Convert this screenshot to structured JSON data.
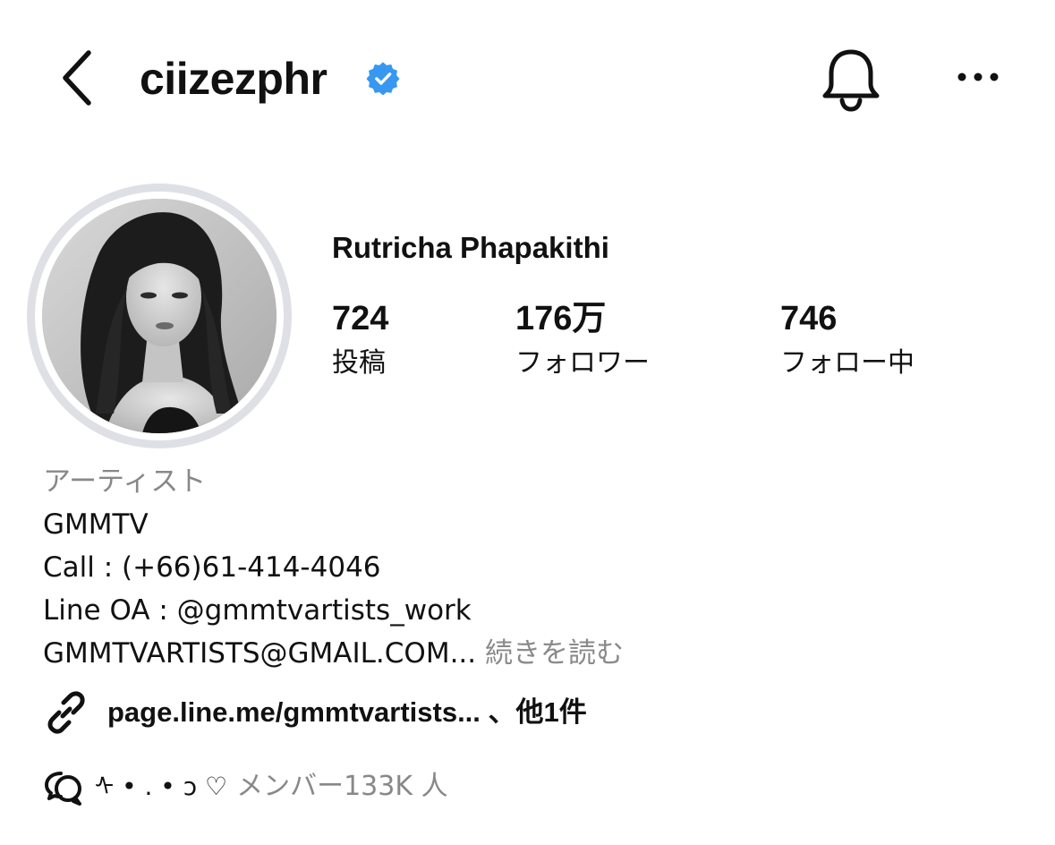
{
  "header": {
    "back_icon": "chevron-left-icon",
    "username": "ciizezphr",
    "verified_icon": "verified-badge-icon",
    "notification_icon": "bell-icon",
    "more_icon": "more-horizontal-icon"
  },
  "profile": {
    "display_name": "Rutricha Phapakithi",
    "avatar_icon": "profile-photo"
  },
  "stats": [
    {
      "value": "724",
      "label": "投稿"
    },
    {
      "value": "176万",
      "label": "フォロワー"
    },
    {
      "value": "746",
      "label": "フォロー中"
    }
  ],
  "bio": {
    "category": "アーティスト",
    "lines": [
      "GMMTV",
      "Call : (+66)61-414-4046",
      "Line OA : @gmmtvartists_work",
      "GMMTVARTISTS@GMAIL.COM..."
    ],
    "more_label": "続きを読む"
  },
  "links": {
    "icon": "link-icon",
    "text": "page.line.me/gmmtvartists... 、他1件"
  },
  "channel": {
    "icon": "broadcast-channel-icon",
    "name": "ᠰ • . • ɔ ♡",
    "meta": "メンバー133K 人"
  },
  "colors": {
    "verified_blue": "#3897f0",
    "text_primary": "#111111",
    "text_secondary": "#888888",
    "avatar_ring": "#dfe0e5"
  }
}
